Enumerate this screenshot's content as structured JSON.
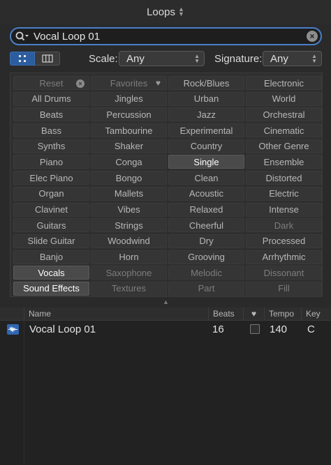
{
  "title": "Loops",
  "search": {
    "value": "Vocal Loop 01"
  },
  "filters": {
    "scale_label": "Scale:",
    "scale_value": "Any",
    "signature_label": "Signature:",
    "signature_value": "Any"
  },
  "keywords": [
    [
      "Reset",
      "Favorites",
      "Rock/Blues",
      "Electronic"
    ],
    [
      "All Drums",
      "Jingles",
      "Urban",
      "World"
    ],
    [
      "Beats",
      "Percussion",
      "Jazz",
      "Orchestral"
    ],
    [
      "Bass",
      "Tambourine",
      "Experimental",
      "Cinematic"
    ],
    [
      "Synths",
      "Shaker",
      "Country",
      "Other Genre"
    ],
    [
      "Piano",
      "Conga",
      "Single",
      "Ensemble"
    ],
    [
      "Elec Piano",
      "Bongo",
      "Clean",
      "Distorted"
    ],
    [
      "Organ",
      "Mallets",
      "Acoustic",
      "Electric"
    ],
    [
      "Clavinet",
      "Vibes",
      "Relaxed",
      "Intense"
    ],
    [
      "Guitars",
      "Strings",
      "Cheerful",
      "Dark"
    ],
    [
      "Slide Guitar",
      "Woodwind",
      "Dry",
      "Processed"
    ],
    [
      "Banjo",
      "Horn",
      "Grooving",
      "Arrhythmic"
    ],
    [
      "Vocals",
      "Saxophone",
      "Melodic",
      "Dissonant"
    ],
    [
      "Sound Effects",
      "Textures",
      "Part",
      "Fill"
    ]
  ],
  "selected_keywords": [
    "Single",
    "Vocals",
    "Sound Effects"
  ],
  "table": {
    "columns": [
      "Name",
      "Beats",
      "",
      "Tempo",
      "Key"
    ],
    "rows": [
      {
        "name": "Vocal Loop 01",
        "beats": "16",
        "tempo": "140",
        "key": "C"
      }
    ]
  },
  "colors": {
    "accent": "#2f67b3",
    "focus_ring": "#4a7fc9",
    "background": "#2a2a2b"
  },
  "icons": [
    "search-icon",
    "clear-icon",
    "grid-view-icon",
    "column-view-icon",
    "heart-icon",
    "waveform-icon"
  ]
}
